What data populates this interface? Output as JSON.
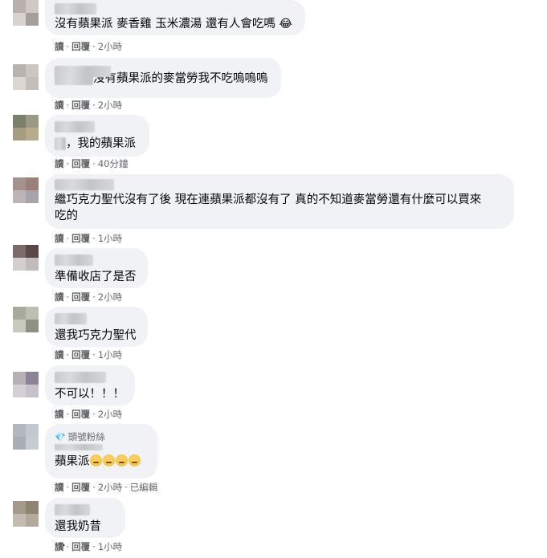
{
  "action_labels": {
    "read": "讀",
    "reply": "回覆",
    "dot": "·"
  },
  "comments": [
    {
      "text": "沒有蘋果派 麥香雞 玉米濃湯 還有人會吃嗎",
      "emoji": "😂",
      "time": "2小時"
    },
    {
      "text": "沒有蘋果派的麥當勞我不吃嗚嗚嗚",
      "time": "2小時"
    },
    {
      "text": "，我的蘋果派",
      "time": "40分鐘"
    },
    {
      "text": "繼巧克力聖代沒有了後 現在連蘋果派都沒有了 真的不知道麥當勞還有什麼可以買來\n吃的",
      "time": "1小時"
    },
    {
      "text": "準備收店了是否",
      "time": "2小時"
    },
    {
      "text": "還我巧克力聖代",
      "time": "1小時"
    },
    {
      "text": "不可以！！！",
      "time": "2小時"
    },
    {
      "badge": "頭號粉絲",
      "text": "蘋果派",
      "emoji_count": 4,
      "time": "2小時",
      "edited": "已編輯"
    },
    {
      "text": "還我奶昔 ...",
      "time": "1小時"
    }
  ],
  "colors": {
    "bubble": "#f0f2f5",
    "meta_text": "#65676b",
    "text": "#050505"
  }
}
